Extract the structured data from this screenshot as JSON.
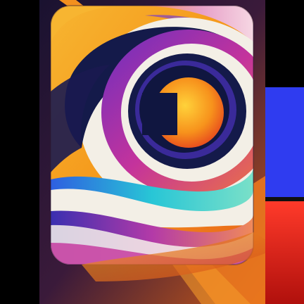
{
  "image": {
    "description_kind": "abstract-app-icon-artwork",
    "icon_name": "swirl-app-icon"
  },
  "palette": {
    "background_black": "#000000",
    "navy": "#141a4a",
    "orange": "#f59a1c",
    "deep_orange": "#e8641a",
    "magenta": "#c4339c",
    "purple": "#7a3fc8",
    "cream": "#f3efe6",
    "cyan": "#28c6d6",
    "royal_blue": "#2e5fe0",
    "strip_blue": "#2f3cf0",
    "strip_red": "#e0241e"
  }
}
